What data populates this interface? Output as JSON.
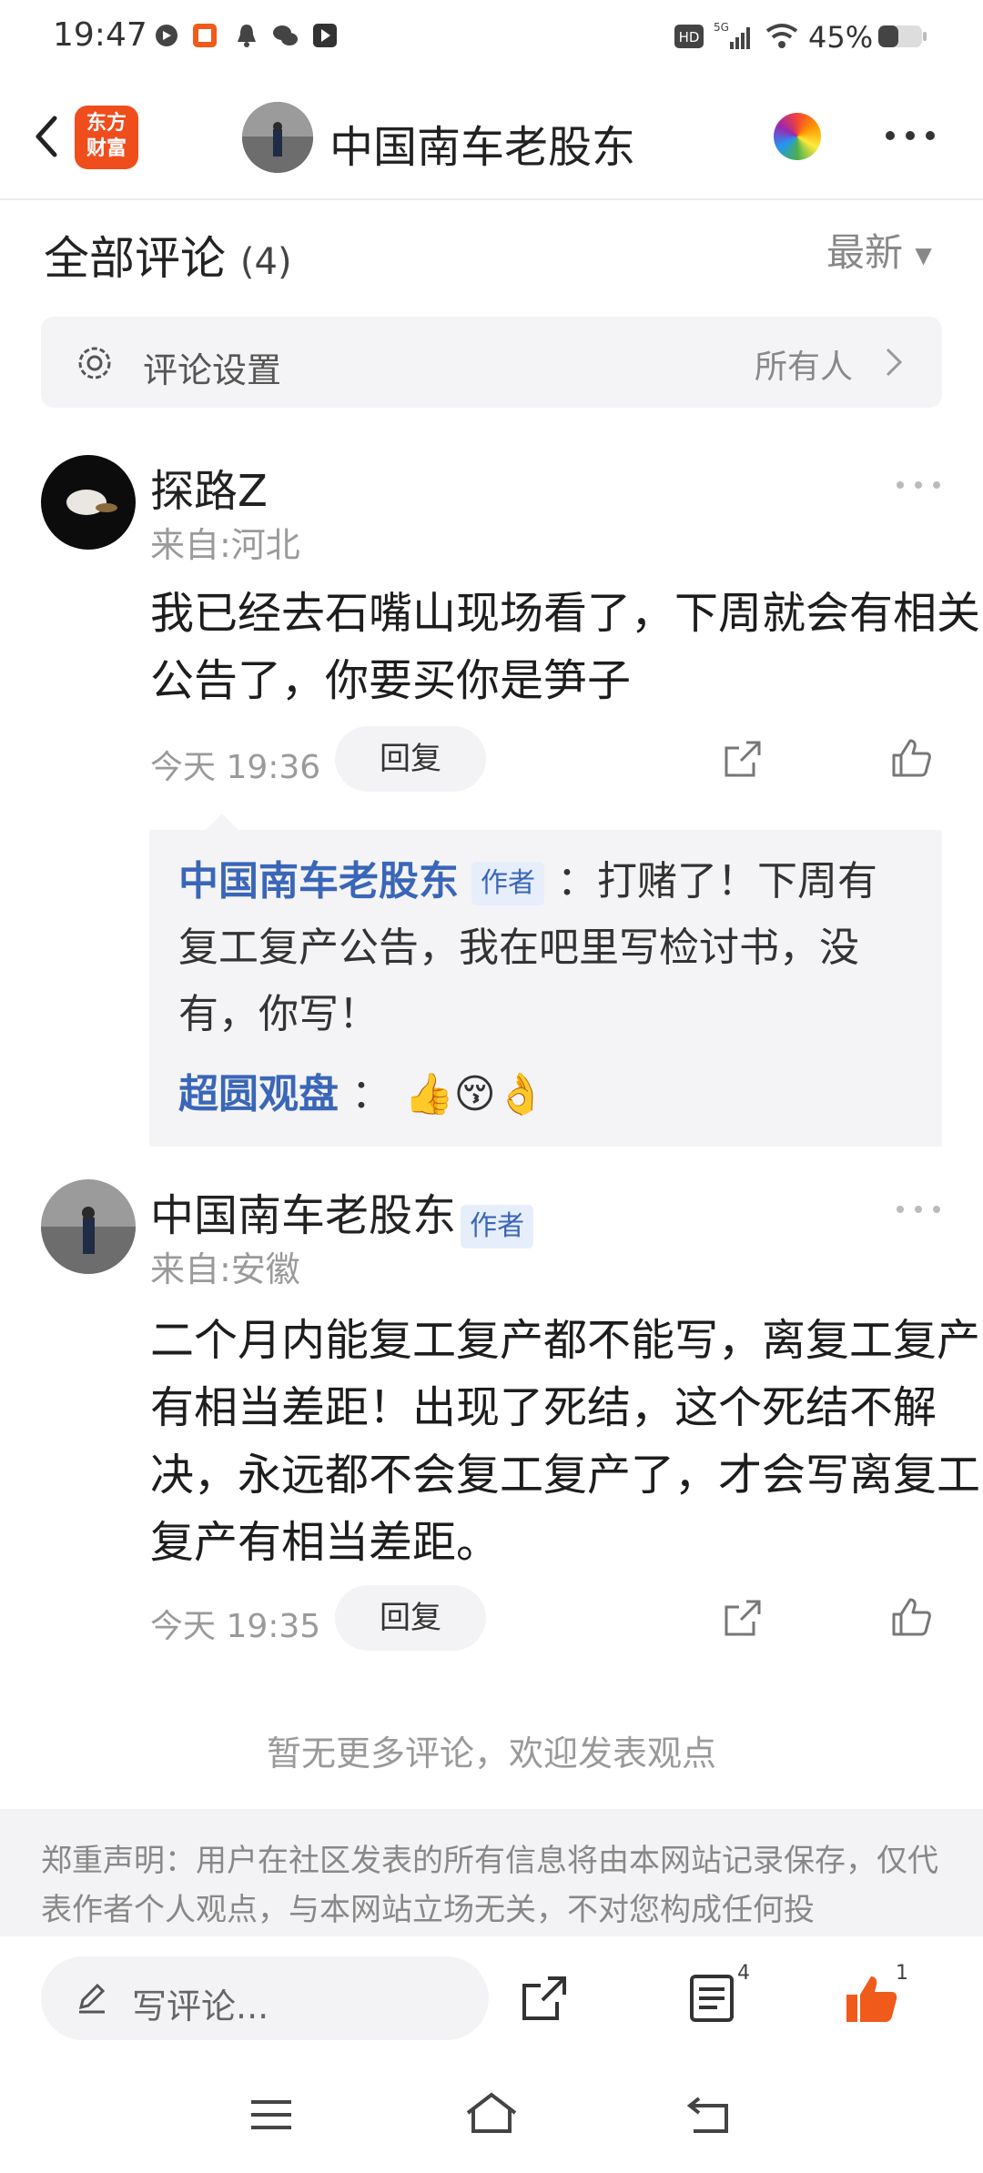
{
  "status_bar": {
    "time": "19:47",
    "battery": "45%"
  },
  "header": {
    "logo_text_1": "东方",
    "logo_text_2": "财富",
    "title": "中国南车老股东"
  },
  "comments_header": {
    "title": "全部评论",
    "count": "(4)",
    "sort_label": "最新"
  },
  "settings_row": {
    "label": "评论设置",
    "value": "所有人"
  },
  "comments": [
    {
      "username": "探路Z",
      "location": "来自:河北",
      "text": "我已经去石嘴山现场看了，下周就会有相关公告了，你要买你是笋子",
      "time": "今天 19:36",
      "reply_label": "回复",
      "replies": [
        {
          "name": "中国南车老股东",
          "tag": "作者",
          "text": "：打赌了！下周有复工复产公告，我在吧里写检讨书，没有，你写！"
        },
        {
          "name": "超圆观盘",
          "text": "："
        }
      ]
    },
    {
      "username": "中国南车老股东",
      "tag": "作者",
      "location": "来自:安徽",
      "text": "二个月内能复工复产都不能写，离复工复产有相当差距！出现了死结，这个死结不解决，永远都不会复工复产了，才会写离复工复产有相当差距。",
      "time": "今天 19:35",
      "reply_label": "回复"
    }
  ],
  "no_more": "暂无更多评论，欢迎发表观点",
  "disclaimer": "郑重声明：用户在社区发表的所有信息将由本网站记录保存，仅代表作者个人观点，与本网站立场无关，不对您构成任何投",
  "bottom_bar": {
    "write_placeholder": "写评论...",
    "comments_badge": "4",
    "likes_badge": "1"
  },
  "colors": {
    "accent": "#f05a1a",
    "link": "#3a66b8"
  }
}
